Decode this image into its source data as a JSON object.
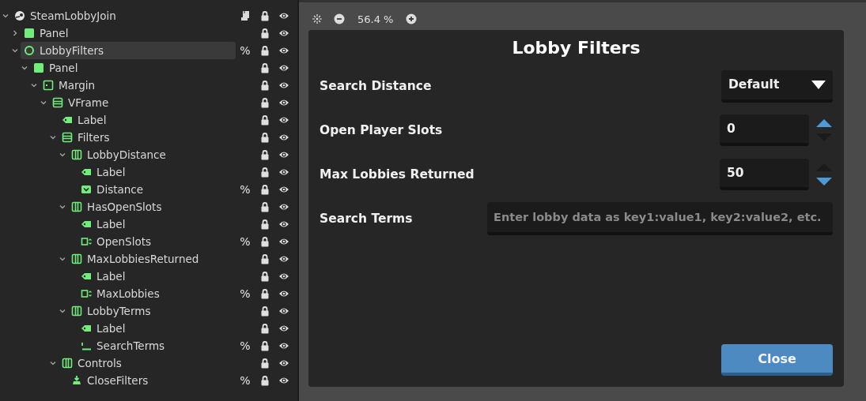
{
  "scene_tree": [
    {
      "name": "SteamLobbyJoin",
      "kind": "scene",
      "expanded": true,
      "selected": false,
      "has_script": true,
      "children": [
        {
          "name": "Panel",
          "kind": "panel",
          "expanded": false,
          "selected": false
        },
        {
          "name": "LobbyFilters",
          "kind": "control",
          "expanded": true,
          "selected": true,
          "unique_mark": "%",
          "children": [
            {
              "name": "Panel",
              "kind": "panel",
              "expanded": true,
              "selected": false,
              "children": [
                {
                  "name": "Margin",
                  "kind": "margin",
                  "expanded": true,
                  "selected": false,
                  "children": [
                    {
                      "name": "VFrame",
                      "kind": "vbox",
                      "expanded": true,
                      "selected": false,
                      "children": [
                        {
                          "name": "Label",
                          "kind": "label",
                          "selected": false
                        },
                        {
                          "name": "Filters",
                          "kind": "vbox",
                          "expanded": true,
                          "selected": false,
                          "children": [
                            {
                              "name": "LobbyDistance",
                              "kind": "hbox",
                              "expanded": true,
                              "selected": false,
                              "children": [
                                {
                                  "name": "Label",
                                  "kind": "label",
                                  "selected": false
                                },
                                {
                                  "name": "Distance",
                                  "kind": "option",
                                  "selected": false,
                                  "unique_mark": "%"
                                }
                              ]
                            },
                            {
                              "name": "HasOpenSlots",
                              "kind": "hbox",
                              "expanded": true,
                              "selected": false,
                              "children": [
                                {
                                  "name": "Label",
                                  "kind": "label",
                                  "selected": false
                                },
                                {
                                  "name": "OpenSlots",
                                  "kind": "spin",
                                  "selected": false,
                                  "unique_mark": "%"
                                }
                              ]
                            },
                            {
                              "name": "MaxLobbiesReturned",
                              "kind": "hbox",
                              "expanded": true,
                              "selected": false,
                              "children": [
                                {
                                  "name": "Label",
                                  "kind": "label",
                                  "selected": false
                                },
                                {
                                  "name": "MaxLobbies",
                                  "kind": "spin",
                                  "selected": false,
                                  "unique_mark": "%"
                                }
                              ]
                            },
                            {
                              "name": "LobbyTerms",
                              "kind": "hbox",
                              "expanded": true,
                              "selected": false,
                              "children": [
                                {
                                  "name": "Label",
                                  "kind": "label",
                                  "selected": false
                                },
                                {
                                  "name": "SearchTerms",
                                  "kind": "lineedit",
                                  "selected": false,
                                  "unique_mark": "%"
                                }
                              ]
                            }
                          ]
                        },
                        {
                          "name": "Controls",
                          "kind": "hbox",
                          "expanded": true,
                          "selected": false,
                          "children": [
                            {
                              "name": "CloseFilters",
                              "kind": "button",
                              "selected": false,
                              "unique_mark": "%"
                            }
                          ]
                        }
                      ]
                    }
                  ]
                }
              ]
            }
          ]
        }
      ]
    }
  ],
  "viewport": {
    "zoom": "56.4 %"
  },
  "dialog": {
    "title": "Lobby Filters",
    "rows": [
      {
        "kind": "dropdown",
        "label": "Search Distance",
        "value": "Default"
      },
      {
        "kind": "spin",
        "label": "Open Player Slots",
        "value": "0",
        "up_enabled": true,
        "down_enabled": false
      },
      {
        "kind": "spin",
        "label": "Max Lobbies Returned",
        "value": "50",
        "up_enabled": false,
        "down_enabled": true
      },
      {
        "kind": "text",
        "label": "Search Terms",
        "placeholder": "Enter lobby data as key1:value1, key2:value2, etc."
      }
    ],
    "close_button": "Close"
  }
}
